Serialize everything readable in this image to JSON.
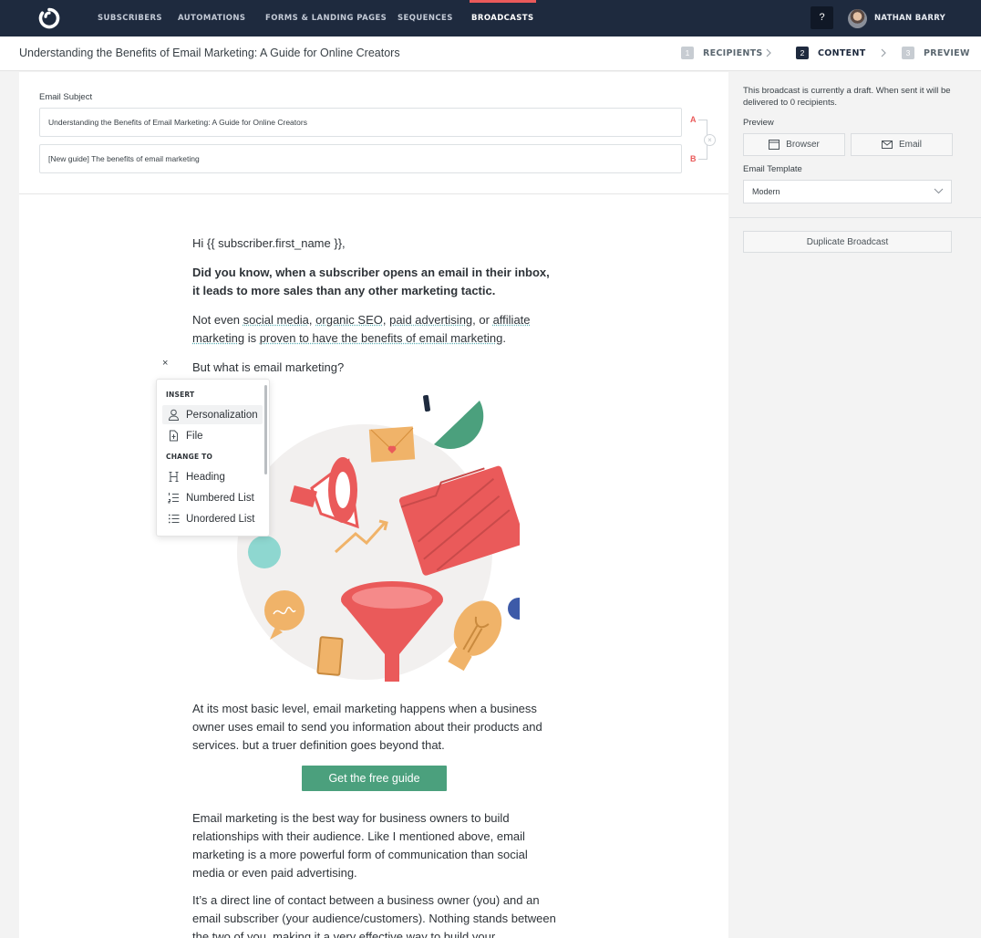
{
  "nav": {
    "items": [
      {
        "label": "SUBSCRIBERS",
        "active": false
      },
      {
        "label": "AUTOMATIONS",
        "active": false
      },
      {
        "label": "FORMS & LANDING PAGES",
        "active": false
      },
      {
        "label": "SEQUENCES",
        "active": false
      },
      {
        "label": "BROADCASTS",
        "active": true
      }
    ],
    "help_label": "?",
    "user_name": "NATHAN BARRY",
    "accent_color": "#ea5a5a",
    "bg_color": "#1e2a3e"
  },
  "header": {
    "title": "Understanding the Benefits of Email Marketing: A Guide for Online Creators",
    "steps": [
      {
        "num": "1",
        "label": "RECIPIENTS",
        "active": false
      },
      {
        "num": "2",
        "label": "CONTENT",
        "active": true
      },
      {
        "num": "3",
        "label": "PREVIEW",
        "active": false
      }
    ]
  },
  "subject": {
    "label": "Email Subject",
    "variant_a": "Understanding the Benefits of Email Marketing: A Guide for Online Creators",
    "variant_b": "[New guide] The benefits of email marketing",
    "letter_a": "A",
    "letter_b": "B"
  },
  "email": {
    "greeting": "Hi {{ subscriber.first_name }},",
    "bold_para": "Did you know, when a subscriber opens an email in their inbox, it leads to more sales than any other marketing tactic.",
    "links_para": {
      "prefix": "Not even ",
      "link1": "social media",
      "sep1": ", ",
      "link2": "organic SEO",
      "sep2": ", ",
      "link3": "paid advertising",
      "sep3": ", or ",
      "link4": "affiliate marketing",
      "sep4": " is ",
      "link5": "proven to have the benefits of email marketing",
      "suffix": "."
    },
    "question": "But what is email marketing?",
    "basic_para": "At its most basic level, email marketing happens when a business owner uses email to send you information about their products and services. but a truer definition goes beyond that.",
    "cta_label": "Get the free guide",
    "cta_color": "#4ba07d",
    "best_para": "Email marketing is the best way for business owners to build relationships with their audience. Like I mentioned above, email marketing is a more powerful form of communication than social media or even paid advertising.",
    "direct_para": "It’s a direct line of contact between a business owner (you) and an email subscriber (your audience/customers). Nothing stands between the two of you, making it a very effective way to build your"
  },
  "insert_menu": {
    "close_label": "×",
    "insert_heading": "INSERT",
    "change_heading": "CHANGE TO",
    "insert_items": [
      {
        "label": "Personalization",
        "icon": "person-icon"
      },
      {
        "label": "File",
        "icon": "file-icon"
      }
    ],
    "change_items": [
      {
        "label": "Heading",
        "icon": "heading-icon"
      },
      {
        "label": "Numbered List",
        "icon": "numbered-list-icon"
      },
      {
        "label": "Unordered List",
        "icon": "unordered-list-icon"
      }
    ]
  },
  "sidebar": {
    "draft_note": "This broadcast is currently a draft. When sent it will be delivered to 0 recipients.",
    "preview_label": "Preview",
    "browser_label": "Browser",
    "email_label": "Email",
    "template_label": "Email Template",
    "template_value": "Modern",
    "duplicate_label": "Duplicate Broadcast"
  }
}
